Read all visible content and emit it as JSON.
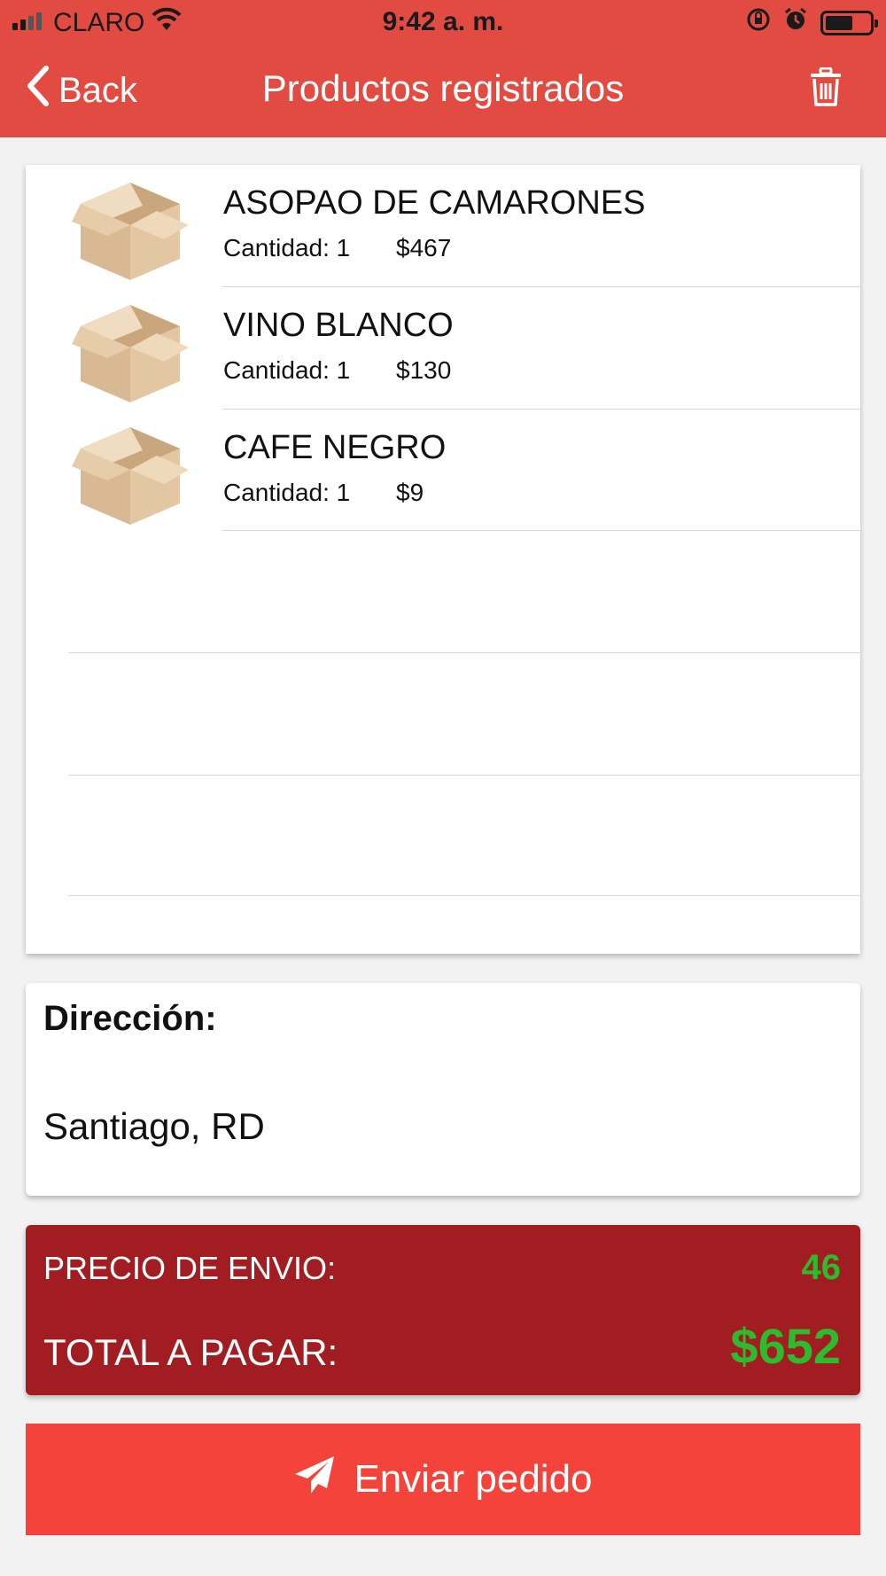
{
  "status_bar": {
    "carrier": "CLARO",
    "time": "9:42 a. m."
  },
  "nav": {
    "back_label": "Back",
    "title": "Productos registrados"
  },
  "products": [
    {
      "name": "ASOPAO DE CAMARONES",
      "quantity": "Cantidad: 1",
      "price": "$467",
      "icon": "box-icon"
    },
    {
      "name": "VINO BLANCO",
      "quantity": "Cantidad: 1",
      "price": "$130",
      "icon": "box-icon"
    },
    {
      "name": "CAFE NEGRO",
      "quantity": "Cantidad: 1",
      "price": "$9",
      "icon": "box-icon"
    }
  ],
  "address": {
    "label": "Dirección:",
    "value": "Santiago, RD"
  },
  "summary": {
    "shipping_label": "PRECIO DE ENVIO:",
    "shipping_value": "46",
    "total_label": "TOTAL A PAGAR:",
    "total_value": "$652"
  },
  "send_button": {
    "label": "Enviar pedido",
    "icon": "paper-plane-icon"
  },
  "colors": {
    "header": "#e24b42",
    "summary_bg": "#a11d21",
    "amount_green": "#2dbb2d",
    "send_button": "#f4433a"
  }
}
